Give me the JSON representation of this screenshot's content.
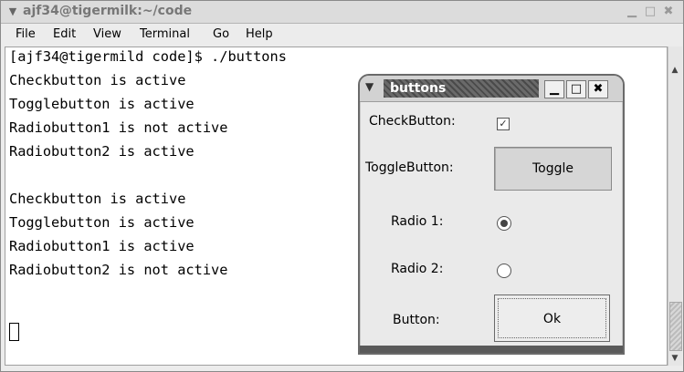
{
  "window": {
    "title": "ajf34@tigermilk:~/code",
    "menu_icon": "chevron-down-icon",
    "controls": [
      "minimize-icon",
      "maximize-icon",
      "close-icon"
    ]
  },
  "menubar": [
    "File",
    "Edit",
    "View",
    "Terminal",
    "Go",
    "Help"
  ],
  "terminal": {
    "lines": [
      "[ajf34@tigermild code]$ ./buttons",
      "Checkbutton is active",
      "Togglebutton is active",
      "Radiobutton1 is not active",
      "Radiobutton2 is active",
      "",
      "Checkbutton is active",
      "Togglebutton is active",
      "Radiobutton1 is active",
      "Radiobutton2 is not active"
    ]
  },
  "dialog": {
    "title": "buttons",
    "check_label": "CheckButton:",
    "check_checked": true,
    "toggle_label": "ToggleButton:",
    "toggle_button": "Toggle",
    "radio1_label": "Radio 1:",
    "radio1_selected": true,
    "radio2_label": "Radio 2:",
    "radio2_selected": false,
    "button_label": "Button:",
    "ok_button": "Ok"
  }
}
